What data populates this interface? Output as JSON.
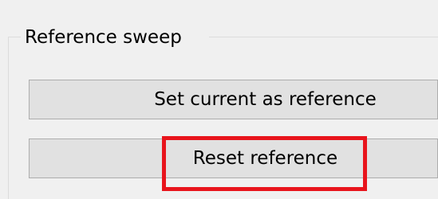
{
  "group": {
    "title": "Reference sweep"
  },
  "buttons": {
    "set_current_as_reference": "Set current as reference",
    "reset_reference": "Reset reference"
  },
  "highlight": {
    "target": "reset_reference",
    "color": "#e8141c"
  }
}
